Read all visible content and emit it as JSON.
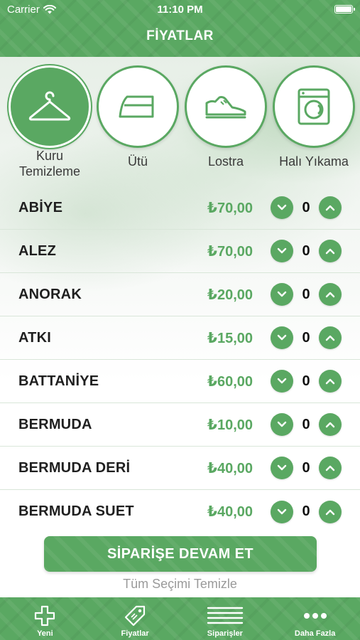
{
  "status_bar": {
    "carrier": "Carrier",
    "time": "11:10 PM"
  },
  "header": {
    "title": "FİYATLAR"
  },
  "categories": [
    {
      "label": "Kuru Temizleme",
      "icon": "hanger-icon",
      "active": true
    },
    {
      "label": "Ütü",
      "icon": "iron-icon",
      "active": false
    },
    {
      "label": "Lostra",
      "icon": "shoe-icon",
      "active": false
    },
    {
      "label": "Halı Yıkama",
      "icon": "washing-machine-icon",
      "active": false
    }
  ],
  "items": [
    {
      "name": "ABİYE",
      "price": "₺70,00",
      "qty": "0"
    },
    {
      "name": "ALEZ",
      "price": "₺70,00",
      "qty": "0"
    },
    {
      "name": "ANORAK",
      "price": "₺20,00",
      "qty": "0"
    },
    {
      "name": "ATKI",
      "price": "₺15,00",
      "qty": "0"
    },
    {
      "name": "BATTANİYE",
      "price": "₺60,00",
      "qty": "0"
    },
    {
      "name": "BERMUDA",
      "price": "₺10,00",
      "qty": "0"
    },
    {
      "name": "BERMUDA DERİ",
      "price": "₺40,00",
      "qty": "0"
    },
    {
      "name": "BERMUDA SUET",
      "price": "₺40,00",
      "qty": "0"
    }
  ],
  "actions": {
    "continue_label": "SİPARİŞE DEVAM ET",
    "clear_label": "Tüm Seçimi Temizle"
  },
  "tabbar": [
    {
      "label": "Yeni",
      "icon": "plus-icon"
    },
    {
      "label": "Fiyatlar",
      "icon": "price-tag-icon"
    },
    {
      "label": "Siparişler",
      "icon": "list-icon"
    },
    {
      "label": "Daha Fazla",
      "icon": "more-icon"
    }
  ],
  "colors": {
    "accent": "#5aa862",
    "price_text": "#5aa862",
    "clear_text": "#9a9a9a"
  }
}
